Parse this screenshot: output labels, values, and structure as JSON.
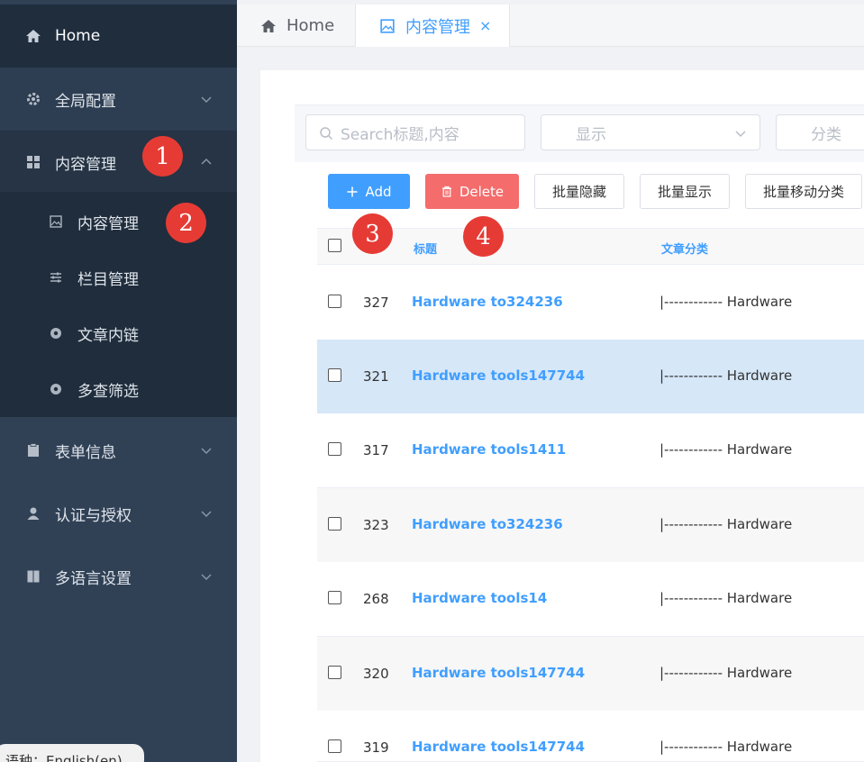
{
  "sidebar": {
    "home": "Home",
    "global_config": "全局配置",
    "content_mgmt": "内容管理",
    "sub_items": [
      "内容管理",
      "栏目管理",
      "文章内链",
      "多查筛选"
    ],
    "form_info": "表单信息",
    "auth": "认证与授权",
    "lang_settings": "多语言设置",
    "lang_badge": "语种：English(en)"
  },
  "tabs": {
    "home": "Home",
    "active": "内容管理",
    "close": "×"
  },
  "filters": {
    "search_placeholder": "Search标题,内容",
    "show_select": "显示",
    "category_select": "分类"
  },
  "toolbar": {
    "add": "Add",
    "delete": "Delete",
    "batch_hide": "批量隐藏",
    "batch_show": "批量显示",
    "batch_move": "批量移动分类"
  },
  "table": {
    "headers": {
      "title": "标题",
      "category": "文章分类"
    },
    "rows": [
      {
        "id": "327",
        "title": "Hardware to324236",
        "category": "|------------ Hardware"
      },
      {
        "id": "321",
        "title": "Hardware tools147744",
        "category": "|------------ Hardware"
      },
      {
        "id": "317",
        "title": "Hardware tools1411",
        "category": "|------------ Hardware"
      },
      {
        "id": "323",
        "title": "Hardware to324236",
        "category": "|------------ Hardware"
      },
      {
        "id": "268",
        "title": "Hardware tools14",
        "category": "|------------ Hardware"
      },
      {
        "id": "320",
        "title": "Hardware tools147744",
        "category": "|------------ Hardware"
      },
      {
        "id": "319",
        "title": "Hardware tools147744",
        "category": "|------------ Hardware"
      }
    ]
  },
  "callouts": [
    "1",
    "2",
    "3",
    "4"
  ],
  "colors": {
    "sidebar_bg": "#304156",
    "accent": "#409eff",
    "danger": "#f56c6c",
    "callout": "#e63b35",
    "row_highlight": "#d6e7f8"
  }
}
